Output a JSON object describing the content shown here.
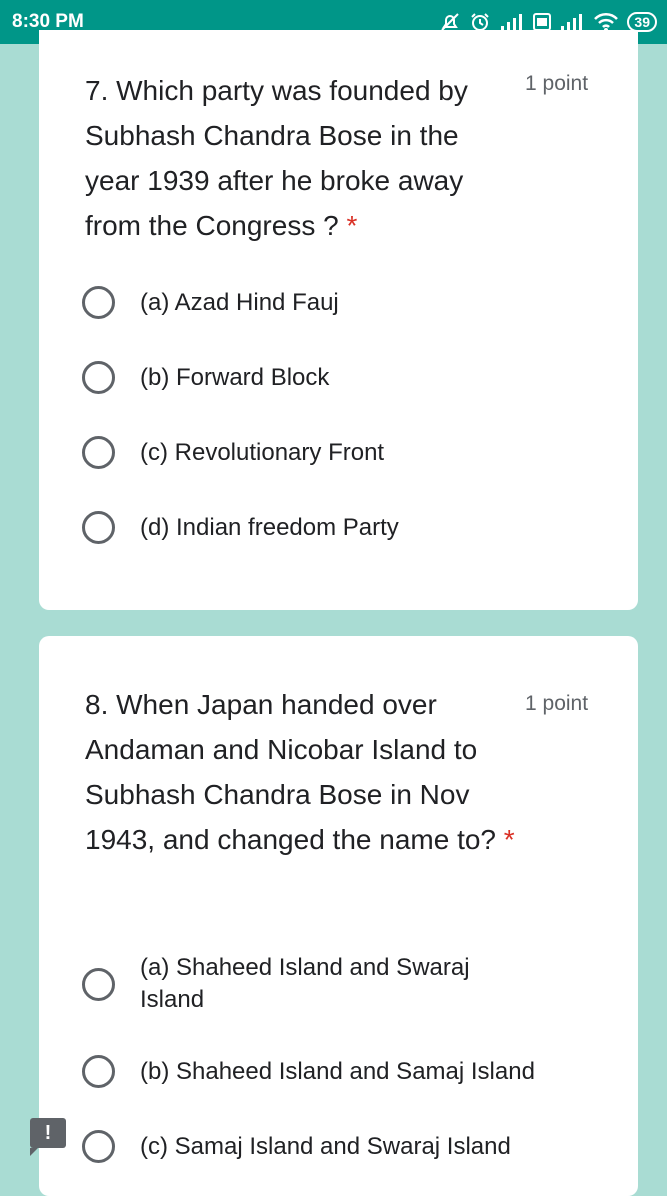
{
  "status_bar": {
    "time": "8:30 PM",
    "battery": "39"
  },
  "questions": [
    {
      "text": "7. Which party was founded by Subhash Chandra Bose in the year 1939 after he broke away from the Congress ?",
      "required_mark": "*",
      "points": "1 point",
      "options": [
        "(a) Azad Hind Fauj",
        "(b) Forward Block",
        "(c) Revolutionary Front",
        "(d) Indian freedom Party"
      ]
    },
    {
      "text": "8. When Japan handed over Andaman and Nicobar Island to Subhash Chandra Bose in Nov 1943, and changed the name to?",
      "required_mark": "*",
      "points": "1 point",
      "options": [
        "(a) Shaheed Island and Swaraj Island",
        "(b) Shaheed Island and Samaj Island",
        "(c) Samaj Island and Swaraj Island"
      ]
    }
  ],
  "feedback_badge": "!"
}
